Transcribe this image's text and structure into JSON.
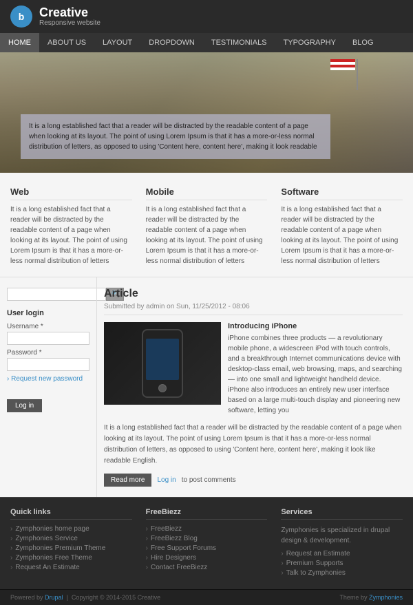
{
  "header": {
    "logo_letter": "b",
    "brand_name": "Creative",
    "brand_tagline": "Responsive website"
  },
  "nav": {
    "items": [
      {
        "label": "HOME",
        "active": true
      },
      {
        "label": "ABOUT US",
        "active": false
      },
      {
        "label": "LAYOUT",
        "active": false
      },
      {
        "label": "DROPDOWN",
        "active": false
      },
      {
        "label": "TESTIMONIALS",
        "active": false
      },
      {
        "label": "TYPOGRAPHY",
        "active": false
      },
      {
        "label": "BLOG",
        "active": false
      }
    ]
  },
  "hero": {
    "caption": "It is a long established fact that a reader will be distracted by the readable content of a page when looking at its layout. The point of using Lorem Ipsum is that it has a more-or-less normal distribution of letters, as opposed to using 'Content here, content here', making it look readable"
  },
  "three_cols": [
    {
      "title": "Web",
      "body": "It is a long established fact that a reader will be distracted by the readable content of a page when looking at its layout.\n\nThe point of using Lorem Ipsum is that it has a more-or-less normal distribution of letters"
    },
    {
      "title": "Mobile",
      "body": "It is a long established fact that a reader will be distracted by the readable content of a page when looking at its layout.\n\nThe point of using Lorem Ipsum is that it has a more-or-less normal distribution of letters"
    },
    {
      "title": "Software",
      "body": "It is a long established fact that a reader will be distracted by the readable content of a page when looking at its layout.\n\nThe point of using Lorem Ipsum is that it has a more-or-less normal distribution of letters"
    }
  ],
  "sidebar": {
    "search_placeholder": "",
    "search_btn": "🔍",
    "user_login": {
      "title": "User login",
      "username_label": "Username *",
      "password_label": "Password *",
      "forgot_link": "› Request new password",
      "login_btn": "Log in"
    }
  },
  "article": {
    "title": "Article",
    "meta": "Submitted by admin on Sun, 11/25/2012 - 08:06",
    "phone_intro_title": "Introducing  iPhone",
    "phone_intro_body": "iPhone combines three products — a revolutionary mobile phone, a widescreen iPod with touch controls, and a breakthrough Internet communications device with desktop-class email, web browsing, maps, and searching — into one small and lightweight handheld device. iPhone also introduces an entirely new user interface based on a large multi-touch display and pioneering new software, letting you",
    "body": "It is a long established fact that a reader will be distracted by the readable content of a page when looking at its layout. The point of using Lorem Ipsum is that it has a more-or-less normal distribution of letters, as opposed to using 'Content here, content here', making it look like readable English.",
    "read_more_btn": "Read more",
    "login_btn": "Log in",
    "comment_text": "to post comments"
  },
  "footer": {
    "cols": [
      {
        "title": "Quick links",
        "links": [
          "Zymphonies home page",
          "Zymphonies Service",
          "Zymphonies Premium Theme",
          "Zymphonies Free Theme",
          "Request An Estimate"
        ]
      },
      {
        "title": "FreeBiezz",
        "links": [
          "FreeBiezz",
          "FreeBiezz Blog",
          "Free Support Forums",
          "Hire Designers",
          "Contact FreeBiezz"
        ]
      },
      {
        "title": "Services",
        "intro": "Zymphonies is specialized in drupal design & development.",
        "links": [
          "Request an Estimate",
          "Premium Supports",
          "Talk to Zymphonies"
        ]
      }
    ],
    "bottom_left": "Powered by",
    "powered_link": "Drupal",
    "copyright": "Copyright © 2014-2015  Creative",
    "theme_text": "Theme by",
    "theme_link": "Zymphonies"
  }
}
